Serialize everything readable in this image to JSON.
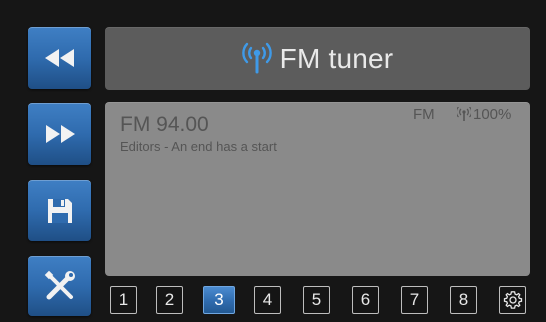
{
  "header": {
    "title": "FM tuner",
    "icon": "antenna-icon"
  },
  "sidebar": {
    "buttons": [
      {
        "name": "rewind-button",
        "icon": "rewind-icon"
      },
      {
        "name": "fast-forward-button",
        "icon": "fast-forward-icon"
      },
      {
        "name": "save-button",
        "icon": "save-icon"
      },
      {
        "name": "tools-button",
        "icon": "tools-icon"
      }
    ]
  },
  "station": {
    "frequency": "FM 94.00",
    "rds_text": "Editors - An end has a start",
    "band": "FM",
    "signal": "100%"
  },
  "presets": {
    "items": [
      "1",
      "2",
      "3",
      "4",
      "5",
      "6",
      "7",
      "8"
    ],
    "active_index": 2,
    "settings_icon": "gear-icon"
  },
  "colors": {
    "accent": "#2f6bae",
    "panel": "#8a8a8a",
    "header": "#5c5c5c",
    "background": "#161616"
  }
}
